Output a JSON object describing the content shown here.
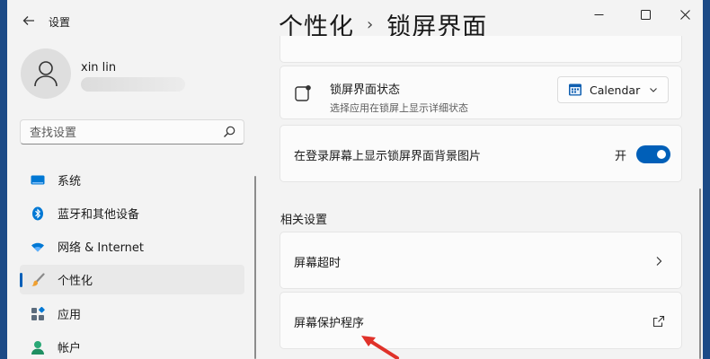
{
  "titlebar": {
    "app_title": "设置"
  },
  "page_header": {
    "parent": "个性化",
    "current": "锁屏界面"
  },
  "user": {
    "name": "xin lin"
  },
  "search": {
    "placeholder": "查找设置"
  },
  "sidebar": {
    "items": [
      {
        "label": "系统",
        "icon": "monitor-icon"
      },
      {
        "label": "蓝牙和其他设备",
        "icon": "bluetooth-icon"
      },
      {
        "label": "网络 & Internet",
        "icon": "wifi-icon"
      },
      {
        "label": "个性化",
        "icon": "brush-icon",
        "active": true
      },
      {
        "label": "应用",
        "icon": "apps-icon"
      },
      {
        "label": "帐户",
        "icon": "account-icon"
      }
    ]
  },
  "lock_status": {
    "title": "锁屏界面状态",
    "subtitle": "选择应用在锁屏上显示详细状态",
    "selected": "Calendar"
  },
  "background_toggle": {
    "label": "在登录屏幕上显示锁屏界面背景图片",
    "state_label": "开",
    "on": true
  },
  "related": {
    "heading": "相关设置",
    "items": [
      {
        "label": "屏幕超时",
        "icon": "chevron-right-icon"
      },
      {
        "label": "屏幕保护程序",
        "icon": "open-external-icon"
      }
    ]
  },
  "colors": {
    "accent": "#005fb8",
    "annotation_arrow": "#e0322a"
  }
}
